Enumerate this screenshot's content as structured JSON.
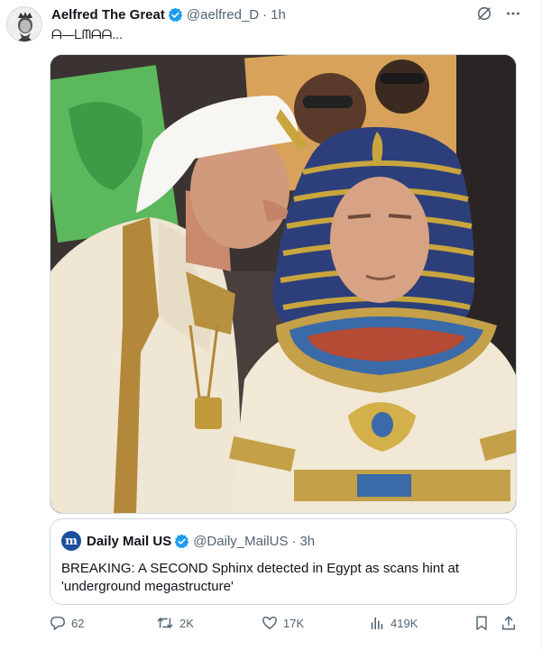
{
  "tweet": {
    "author_name": "Aelfred The Great",
    "handle": "@aelfred_D",
    "separator": "·",
    "time": "1h",
    "text_squiggle": "ᗩ—ᒪᗰᗩᗩ..."
  },
  "quote": {
    "author_name": "Daily Mail US",
    "handle": "@Daily_MailUS",
    "separator": "·",
    "time": "3h",
    "avatar_letter": "m",
    "text": "BREAKING: A SECOND Sphinx detected in Egypt as scans hint at 'underground megastructure'"
  },
  "actions": {
    "replies": "62",
    "reposts": "2K",
    "likes": "17K",
    "views": "419K"
  },
  "colors": {
    "verified": "#1d9bf0",
    "muted_text": "#536471",
    "border": "#cfd9de",
    "quote_avatar": "#1d4f9c"
  },
  "icons": [
    "grok-icon",
    "more-icon",
    "reply-icon",
    "repost-icon",
    "like-icon",
    "views-icon",
    "bookmark-icon",
    "share-icon"
  ]
}
